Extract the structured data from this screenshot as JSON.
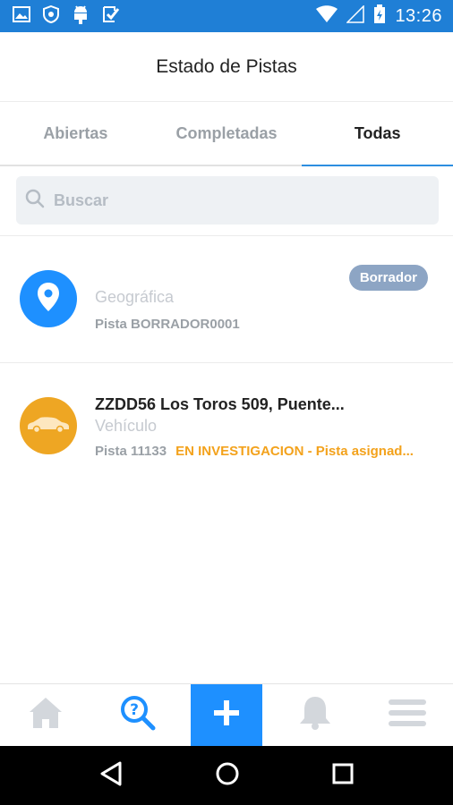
{
  "status_bar": {
    "time": "13:26",
    "left_icons": [
      "image-icon",
      "shield-icon",
      "android-icon",
      "check-app-icon"
    ],
    "right_icons": [
      "wifi-icon",
      "signal-icon",
      "battery-icon"
    ]
  },
  "header": {
    "title": "Estado de Pistas"
  },
  "tabs": [
    {
      "label": "Abiertas",
      "active": false
    },
    {
      "label": "Completadas",
      "active": false
    },
    {
      "label": "Todas",
      "active": true
    }
  ],
  "search": {
    "placeholder": "Buscar",
    "value": ""
  },
  "list": [
    {
      "title": "",
      "type": "Geográfica",
      "id_label": "Pista BORRADOR0001",
      "status": "",
      "badge": "Borrador",
      "icon": "location-pin-icon",
      "color": "#1e90ff"
    },
    {
      "title": "ZZDD56 Los Toros 509, Puente...",
      "type": "Vehículo",
      "id_label": "Pista 11133",
      "status": "EN INVESTIGACION - Pista asignad...",
      "badge": "",
      "icon": "car-icon",
      "color": "#eea623"
    }
  ],
  "bottom_nav": [
    "home-icon",
    "search-help-icon",
    "add-icon",
    "bell-icon",
    "menu-icon"
  ],
  "colors": {
    "primary": "#1e90ff",
    "status_bar": "#1f7fd6",
    "warning": "#f3a21c",
    "badge": "#8da5c4"
  }
}
